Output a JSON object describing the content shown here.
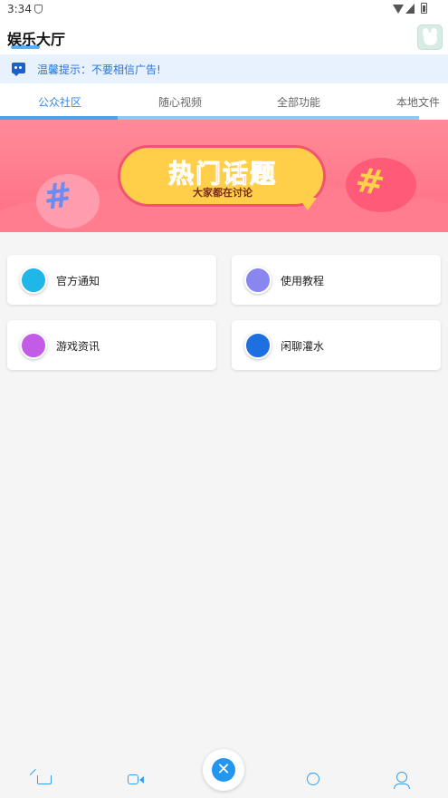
{
  "status_bar": {
    "time": "3:34"
  },
  "app_bar": {
    "title": "娱乐大厅"
  },
  "notice": {
    "text": "温馨提示：不要相信广告!"
  },
  "tabs": [
    {
      "label": "公众社区",
      "active": true
    },
    {
      "label": "随心视频",
      "active": false
    },
    {
      "label": "全部功能",
      "active": false
    },
    {
      "label": "本地文件",
      "active": false
    }
  ],
  "banner": {
    "title": "热门话题",
    "subtitle": "大家都在讨论"
  },
  "categories": [
    {
      "label": "官方通知",
      "icon": "chat-bubble-icon",
      "color": "#1fb6e8"
    },
    {
      "label": "使用教程",
      "icon": "document-icon",
      "color": "#8a86f0"
    },
    {
      "label": "游戏资讯",
      "icon": "crown-icon",
      "color": "#c45be6"
    },
    {
      "label": "闲聊灌水",
      "icon": "pyramid-icon",
      "color": "#1e6fe0"
    }
  ],
  "bottom_nav": [
    {
      "icon": "home-icon"
    },
    {
      "icon": "video-icon"
    },
    {
      "icon": "close-icon"
    },
    {
      "icon": "chat-icon"
    },
    {
      "icon": "user-icon"
    }
  ],
  "colors": {
    "accent": "#2d8af0",
    "notice_bg": "#e8f1fe",
    "banner": "#ff7386"
  }
}
